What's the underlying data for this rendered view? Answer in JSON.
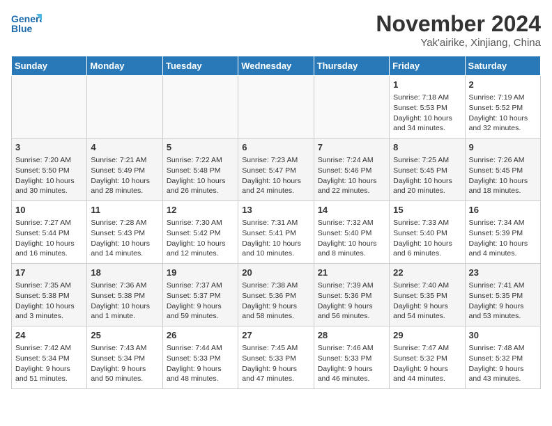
{
  "header": {
    "logo_line1": "General",
    "logo_line2": "Blue",
    "month": "November 2024",
    "location": "Yak'airike, Xinjiang, China"
  },
  "days_of_week": [
    "Sunday",
    "Monday",
    "Tuesday",
    "Wednesday",
    "Thursday",
    "Friday",
    "Saturday"
  ],
  "weeks": [
    [
      {
        "day": "",
        "info": ""
      },
      {
        "day": "",
        "info": ""
      },
      {
        "day": "",
        "info": ""
      },
      {
        "day": "",
        "info": ""
      },
      {
        "day": "",
        "info": ""
      },
      {
        "day": "1",
        "info": "Sunrise: 7:18 AM\nSunset: 5:53 PM\nDaylight: 10 hours and 34 minutes."
      },
      {
        "day": "2",
        "info": "Sunrise: 7:19 AM\nSunset: 5:52 PM\nDaylight: 10 hours and 32 minutes."
      }
    ],
    [
      {
        "day": "3",
        "info": "Sunrise: 7:20 AM\nSunset: 5:50 PM\nDaylight: 10 hours and 30 minutes."
      },
      {
        "day": "4",
        "info": "Sunrise: 7:21 AM\nSunset: 5:49 PM\nDaylight: 10 hours and 28 minutes."
      },
      {
        "day": "5",
        "info": "Sunrise: 7:22 AM\nSunset: 5:48 PM\nDaylight: 10 hours and 26 minutes."
      },
      {
        "day": "6",
        "info": "Sunrise: 7:23 AM\nSunset: 5:47 PM\nDaylight: 10 hours and 24 minutes."
      },
      {
        "day": "7",
        "info": "Sunrise: 7:24 AM\nSunset: 5:46 PM\nDaylight: 10 hours and 22 minutes."
      },
      {
        "day": "8",
        "info": "Sunrise: 7:25 AM\nSunset: 5:45 PM\nDaylight: 10 hours and 20 minutes."
      },
      {
        "day": "9",
        "info": "Sunrise: 7:26 AM\nSunset: 5:45 PM\nDaylight: 10 hours and 18 minutes."
      }
    ],
    [
      {
        "day": "10",
        "info": "Sunrise: 7:27 AM\nSunset: 5:44 PM\nDaylight: 10 hours and 16 minutes."
      },
      {
        "day": "11",
        "info": "Sunrise: 7:28 AM\nSunset: 5:43 PM\nDaylight: 10 hours and 14 minutes."
      },
      {
        "day": "12",
        "info": "Sunrise: 7:30 AM\nSunset: 5:42 PM\nDaylight: 10 hours and 12 minutes."
      },
      {
        "day": "13",
        "info": "Sunrise: 7:31 AM\nSunset: 5:41 PM\nDaylight: 10 hours and 10 minutes."
      },
      {
        "day": "14",
        "info": "Sunrise: 7:32 AM\nSunset: 5:40 PM\nDaylight: 10 hours and 8 minutes."
      },
      {
        "day": "15",
        "info": "Sunrise: 7:33 AM\nSunset: 5:40 PM\nDaylight: 10 hours and 6 minutes."
      },
      {
        "day": "16",
        "info": "Sunrise: 7:34 AM\nSunset: 5:39 PM\nDaylight: 10 hours and 4 minutes."
      }
    ],
    [
      {
        "day": "17",
        "info": "Sunrise: 7:35 AM\nSunset: 5:38 PM\nDaylight: 10 hours and 3 minutes."
      },
      {
        "day": "18",
        "info": "Sunrise: 7:36 AM\nSunset: 5:38 PM\nDaylight: 10 hours and 1 minute."
      },
      {
        "day": "19",
        "info": "Sunrise: 7:37 AM\nSunset: 5:37 PM\nDaylight: 9 hours and 59 minutes."
      },
      {
        "day": "20",
        "info": "Sunrise: 7:38 AM\nSunset: 5:36 PM\nDaylight: 9 hours and 58 minutes."
      },
      {
        "day": "21",
        "info": "Sunrise: 7:39 AM\nSunset: 5:36 PM\nDaylight: 9 hours and 56 minutes."
      },
      {
        "day": "22",
        "info": "Sunrise: 7:40 AM\nSunset: 5:35 PM\nDaylight: 9 hours and 54 minutes."
      },
      {
        "day": "23",
        "info": "Sunrise: 7:41 AM\nSunset: 5:35 PM\nDaylight: 9 hours and 53 minutes."
      }
    ],
    [
      {
        "day": "24",
        "info": "Sunrise: 7:42 AM\nSunset: 5:34 PM\nDaylight: 9 hours and 51 minutes."
      },
      {
        "day": "25",
        "info": "Sunrise: 7:43 AM\nSunset: 5:34 PM\nDaylight: 9 hours and 50 minutes."
      },
      {
        "day": "26",
        "info": "Sunrise: 7:44 AM\nSunset: 5:33 PM\nDaylight: 9 hours and 48 minutes."
      },
      {
        "day": "27",
        "info": "Sunrise: 7:45 AM\nSunset: 5:33 PM\nDaylight: 9 hours and 47 minutes."
      },
      {
        "day": "28",
        "info": "Sunrise: 7:46 AM\nSunset: 5:33 PM\nDaylight: 9 hours and 46 minutes."
      },
      {
        "day": "29",
        "info": "Sunrise: 7:47 AM\nSunset: 5:32 PM\nDaylight: 9 hours and 44 minutes."
      },
      {
        "day": "30",
        "info": "Sunrise: 7:48 AM\nSunset: 5:32 PM\nDaylight: 9 hours and 43 minutes."
      }
    ]
  ]
}
